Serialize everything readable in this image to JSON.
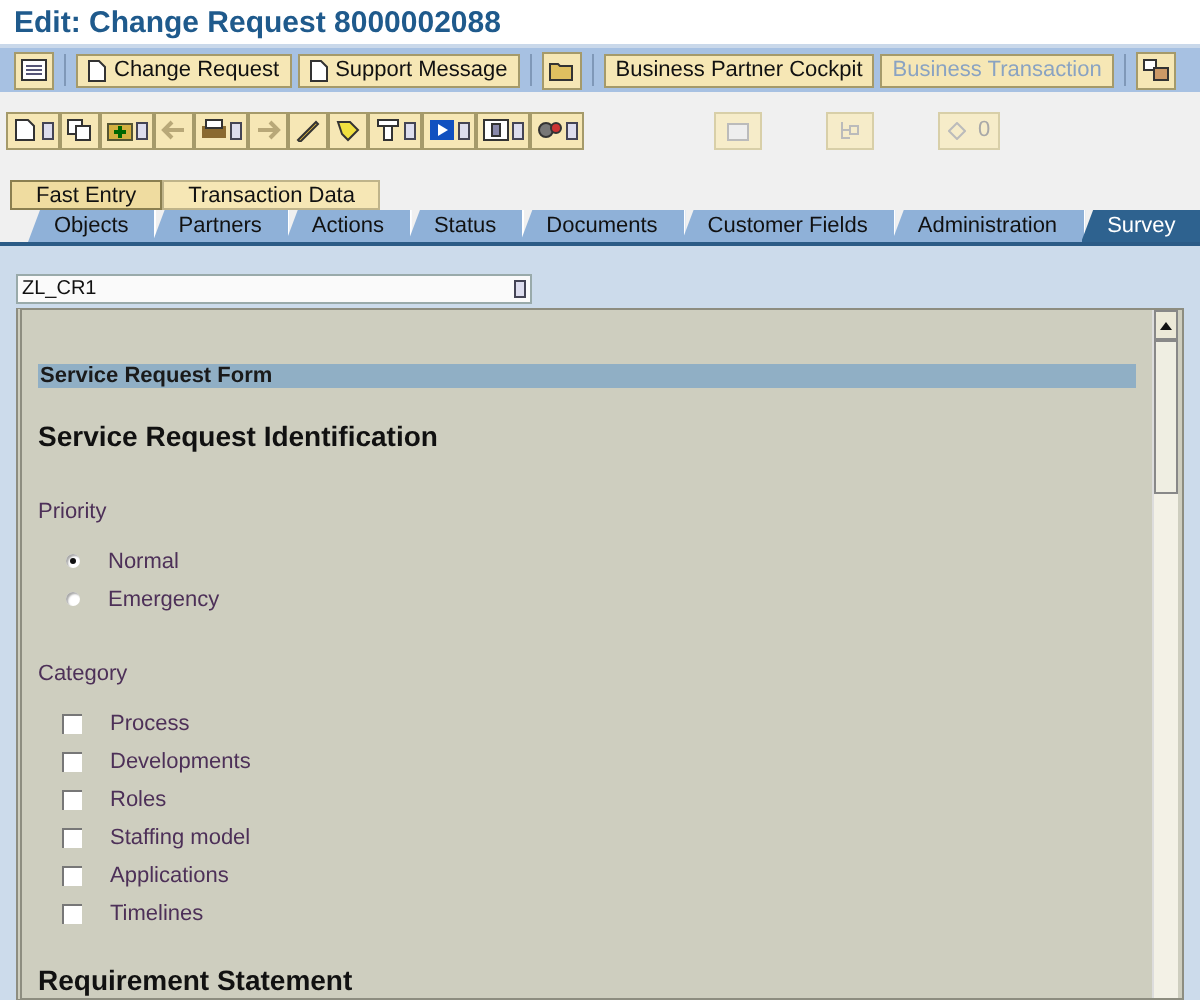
{
  "title": "Edit: Change Request 8000002088",
  "toolbar": {
    "buttons": [
      {
        "label": "Change Request",
        "disabled": false
      },
      {
        "label": "Support Message",
        "disabled": false
      },
      {
        "label": "Business Partner Cockpit",
        "disabled": false
      },
      {
        "label": "Business Transaction",
        "disabled": true
      }
    ]
  },
  "action_bar": {
    "counter": "0"
  },
  "subtabs": [
    {
      "label": "Fast Entry",
      "selected": true
    },
    {
      "label": "Transaction Data",
      "selected": false
    }
  ],
  "tabs": [
    {
      "label": "Objects",
      "selected": false
    },
    {
      "label": "Partners",
      "selected": false
    },
    {
      "label": "Actions",
      "selected": false
    },
    {
      "label": "Status",
      "selected": false
    },
    {
      "label": "Documents",
      "selected": false
    },
    {
      "label": "Customer Fields",
      "selected": false
    },
    {
      "label": "Administration",
      "selected": false
    },
    {
      "label": "Survey",
      "selected": true
    }
  ],
  "survey_select": {
    "value": "ZL_CR1"
  },
  "form": {
    "title": "Service Request Form",
    "sections": [
      {
        "heading": "Service Request Identification",
        "groups": [
          {
            "label": "Priority",
            "kind": "radio",
            "options": [
              {
                "label": "Normal",
                "selected": true
              },
              {
                "label": "Emergency",
                "selected": false
              }
            ]
          },
          {
            "label": "Category",
            "kind": "checkbox",
            "options": [
              {
                "label": "Process",
                "checked": false
              },
              {
                "label": "Developments",
                "checked": false
              },
              {
                "label": "Roles",
                "checked": false
              },
              {
                "label": "Staffing model",
                "checked": false
              },
              {
                "label": "Applications",
                "checked": false
              },
              {
                "label": "Timelines",
                "checked": false
              }
            ]
          }
        ]
      },
      {
        "heading": "Requirement Statement"
      }
    ]
  }
}
